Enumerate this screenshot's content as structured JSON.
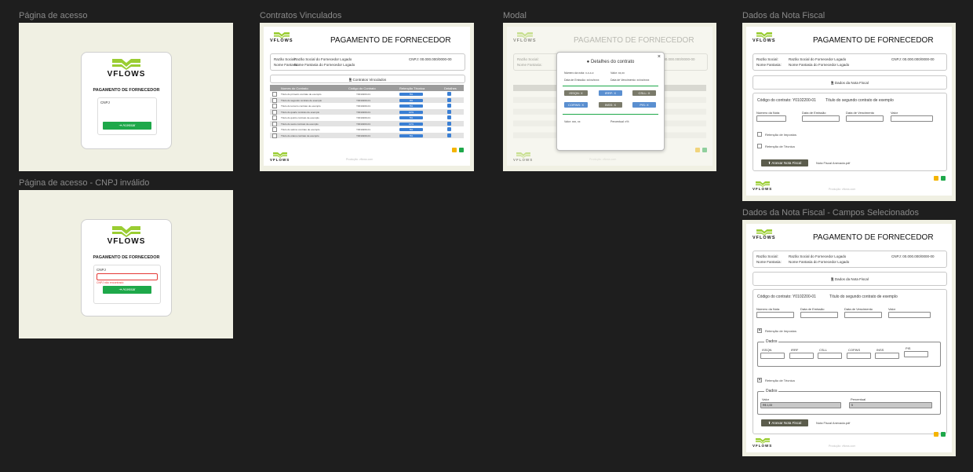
{
  "frames": {
    "login": "Página de acesso",
    "login_invalid": "Página de acesso - CNPJ inválido",
    "contracts": "Contratos Vinculados",
    "modal": "Modal",
    "invoice": "Dados da Nota Fiscal",
    "invoice_selected": "Dados da Nota Fiscal - Campos Selecionados"
  },
  "brand": {
    "name": "VFLOWS",
    "logo_color": "#9acd32"
  },
  "login": {
    "title": "PAGAMENTO DE FORNECEDOR",
    "cnpj_label": "CNPJ",
    "error_text": "CNPJ não encontrado",
    "button": "⇥ Acessar",
    "button_color": "#1ea84a",
    "error_color": "#e53935"
  },
  "app": {
    "title": "PAGAMENTO DE FORNECEDOR",
    "razao_label": "Razão Social:",
    "razao_value": "Razão Social do Fornecedor Logado",
    "fantasia_label": "Nome Fantasia:",
    "fantasia_value": "Nome Fantasia do Fornecedor Logado",
    "cnpj": "CNPJ: 00.000.000/0000-00",
    "footer": "Produção: vflows.com"
  },
  "contracts": {
    "section_title": "🖹 Contratos Vinculados",
    "columns": [
      "Nomes do Contrato",
      "Código do Contrato",
      "Retenção Técnica",
      "Detalhes"
    ],
    "rows": [
      {
        "name": "Título do primeiro contrato de exemplo",
        "code": "Y0010203-01",
        "ret": "5%"
      },
      {
        "name": "Título do segundo contrato de exemplo",
        "code": "Y0010200-01",
        "ret": "0%"
      },
      {
        "name": "Título do terceiro contrato de exemplo",
        "code": "Y0010200-01",
        "ret": "5%"
      },
      {
        "name": "Título do quarto contrato de exemplo",
        "code": "Y0010200-01",
        "ret": "10%"
      },
      {
        "name": "Título do quinto contrato de exemplo",
        "code": "Y0010200-01",
        "ret": "5%"
      },
      {
        "name": "Título do sexto contrato de exemplo",
        "code": "Y0010203-01",
        "ret": "10%"
      },
      {
        "name": "Título do sétimo contrato de exemplo",
        "code": "Y0010200-01",
        "ret": "5%"
      },
      {
        "name": "Título do oitavo contrato de exemplo",
        "code": "Y0010200-01",
        "ret": "5%"
      }
    ]
  },
  "modal": {
    "title": "Detalhes do contrato",
    "close": "×",
    "numero_label": "Número da nota:",
    "numero_value": "x-x-x-x",
    "valor_label": "Valor:",
    "valor_value": "xx,xx",
    "emissao_label": "Data de Emissão:",
    "emissao_value": "xx/xx/xxxx",
    "vencimento_label": "Data de Vencimento:",
    "vencimento_value": "xx/xx/xxxx",
    "taxes": [
      "ISSQN: X",
      "IRRF: X",
      "CSLL: X",
      "COFINS: X",
      "PIS: X",
      "INSS: X"
    ],
    "valor_total": "Valor: xxx, xx",
    "percentual": "Percentual: x%"
  },
  "invoice": {
    "section_title": "🖹 Dados da Nota Fiscal",
    "codigo": "Código do contrato: Y0102200-01",
    "titulo": "Título do segundo contrato de exemplo",
    "fields": [
      "Número da Nota",
      "Data de Emissão",
      "Data de Vencimento",
      "Valor"
    ],
    "ret_impostos": "Retenção de Impostos",
    "ret_tecnica": "Retenção de Técnica",
    "attach": "⬆ Anexar Nota Fiscal",
    "attached_file": "Nota Fiscal Anexada.pdf",
    "dados_legend": "Dados",
    "tax_fields": [
      "ISSQN",
      "IRRF",
      "CSLL",
      "COFINS",
      "INSS",
      "PIS"
    ],
    "valor_label": "Valor",
    "valor_value": "R$ 1,00",
    "percentual_label": "Percentual",
    "percentual_value": "5",
    "check": "✕"
  },
  "colors": {
    "green": "#1ea84a",
    "blue": "#3a7fd4",
    "grey_btn": "#5b5c4c",
    "orange": "#f4b400"
  }
}
